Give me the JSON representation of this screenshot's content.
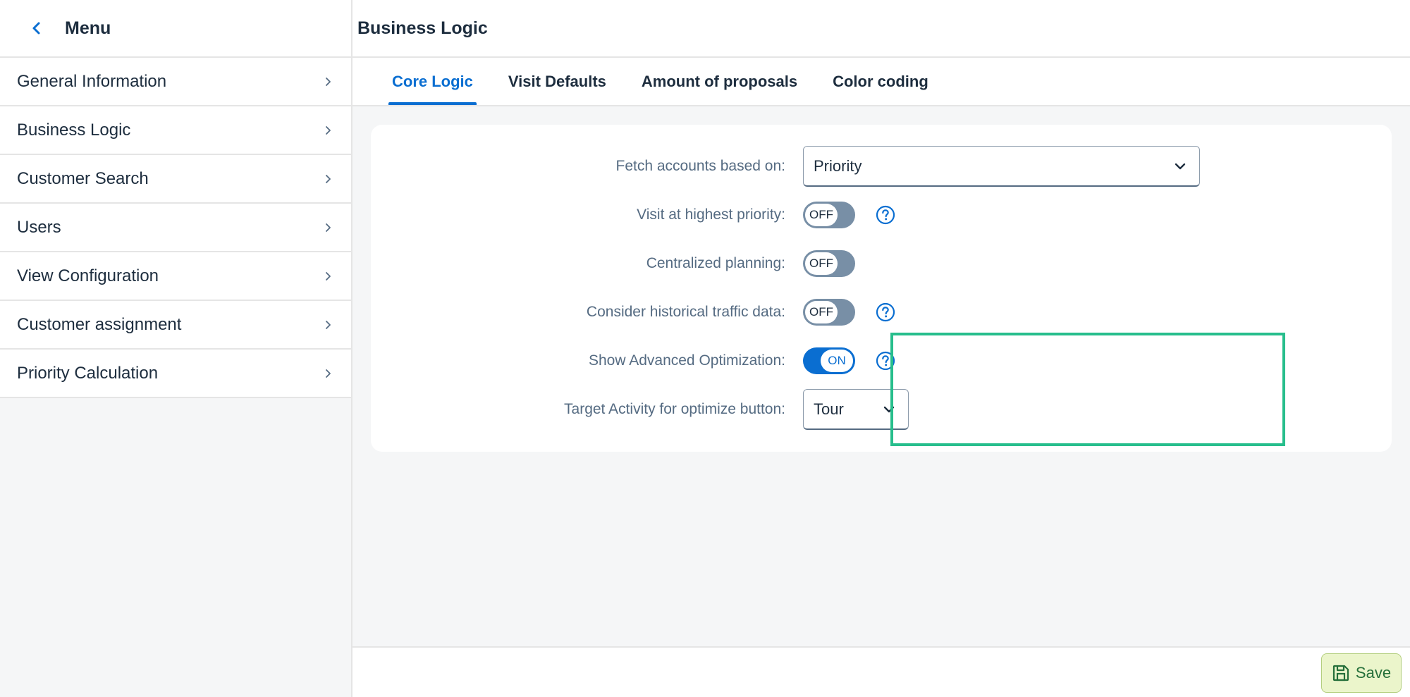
{
  "sidebar": {
    "title": "Menu",
    "items": [
      {
        "label": "General Information"
      },
      {
        "label": "Business Logic"
      },
      {
        "label": "Customer Search"
      },
      {
        "label": "Users"
      },
      {
        "label": "View Configuration"
      },
      {
        "label": "Customer assignment"
      },
      {
        "label": "Priority Calculation"
      }
    ]
  },
  "header": {
    "title": "Business Logic"
  },
  "tabs": [
    {
      "label": "Core Logic",
      "active": true
    },
    {
      "label": "Visit Defaults",
      "active": false
    },
    {
      "label": "Amount of proposals",
      "active": false
    },
    {
      "label": "Color coding",
      "active": false
    }
  ],
  "form": {
    "fetch_accounts": {
      "label": "Fetch accounts based on:",
      "value": "Priority"
    },
    "visit_highest_priority": {
      "label": "Visit at highest priority:",
      "state": "OFF"
    },
    "centralized_planning": {
      "label": "Centralized planning:",
      "state": "OFF"
    },
    "historical_traffic": {
      "label": "Consider historical traffic data:",
      "state": "OFF"
    },
    "advanced_optimization": {
      "label": "Show Advanced Optimization:",
      "state": "ON"
    },
    "target_activity": {
      "label": "Target Activity for optimize button:",
      "value": "Tour"
    }
  },
  "footer": {
    "save_label": "Save"
  },
  "colors": {
    "accent": "#0a6ed1",
    "highlight": "#27be8c",
    "save_bg": "#ebf5cb",
    "save_text": "#256f3a"
  },
  "icons": [
    "chevron-left-icon",
    "chevron-right-icon",
    "chevron-down-icon",
    "help-icon",
    "save-icon"
  ]
}
